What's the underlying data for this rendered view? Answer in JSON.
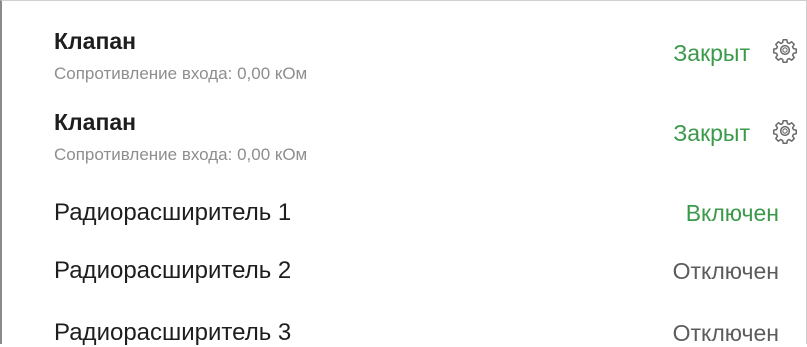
{
  "colors": {
    "active": "#3a9a4a",
    "inactive": "#5c5c5c"
  },
  "rows": [
    {
      "title": "Клапан",
      "subtitle": "Сопротивление входа: 0,00 кОм",
      "status": "Закрыт",
      "status_color": "#3a9a4a",
      "icon": "gear-icon"
    },
    {
      "title": "Клапан",
      "subtitle": "Сопротивление входа: 0,00 кОм",
      "status": "Закрыт",
      "status_color": "#3a9a4a",
      "icon": "gear-icon"
    },
    {
      "title": "Радиорасширитель 1",
      "status": "Включен",
      "status_color": "#3a9a4a"
    },
    {
      "title": "Радиорасширитель 2",
      "status": "Отключен",
      "status_color": "#5c5c5c"
    },
    {
      "title": "Радиорасширитель 3",
      "status": "Отключен",
      "status_color": "#5c5c5c"
    }
  ]
}
